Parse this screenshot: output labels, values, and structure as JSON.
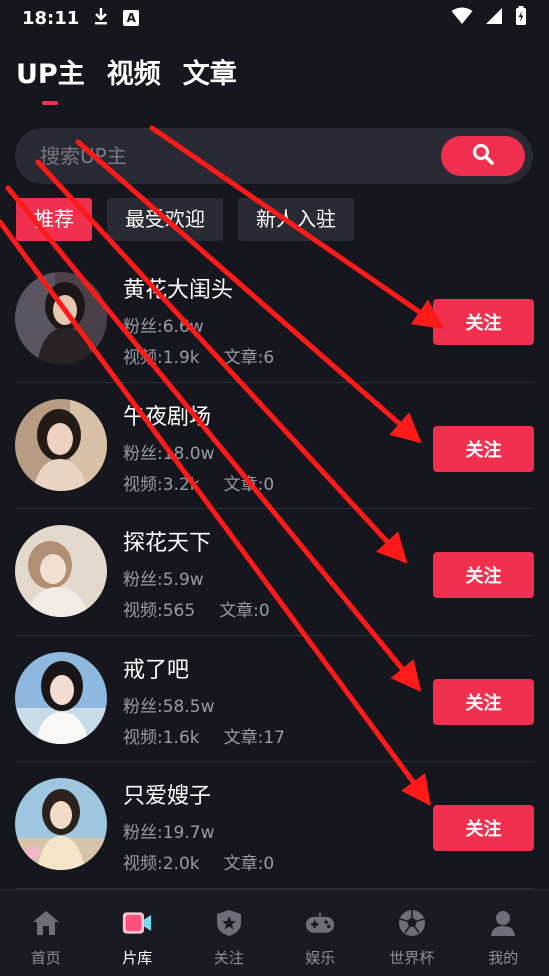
{
  "status_bar": {
    "time": "18:11",
    "notification_badge": "A"
  },
  "top_tabs": [
    {
      "label": "UP主",
      "active": true
    },
    {
      "label": "视频",
      "active": false
    },
    {
      "label": "文章",
      "active": false
    }
  ],
  "search": {
    "placeholder": "搜索UP主"
  },
  "filters": [
    {
      "label": "推荐",
      "active": true
    },
    {
      "label": "最受欢迎",
      "active": false
    },
    {
      "label": "新人入驻",
      "active": false
    }
  ],
  "creators": [
    {
      "name": "黄花大闺头",
      "fans": "粉丝:6.6w",
      "videos": "视频:1.9k",
      "articles": "文章:6",
      "follow_label": "关注"
    },
    {
      "name": "午夜剧场",
      "fans": "粉丝:18.0w",
      "videos": "视频:3.2k",
      "articles": "文章:0",
      "follow_label": "关注"
    },
    {
      "name": "探花天下",
      "fans": "粉丝:5.9w",
      "videos": "视频:565",
      "articles": "文章:0",
      "follow_label": "关注"
    },
    {
      "name": "戒了吧",
      "fans": "粉丝:58.5w",
      "videos": "视频:1.6k",
      "articles": "文章:17",
      "follow_label": "关注"
    },
    {
      "name": "只爱嫂子",
      "fans": "粉丝:19.7w",
      "videos": "视频:2.0k",
      "articles": "文章:0",
      "follow_label": "关注"
    }
  ],
  "bottom_nav": [
    {
      "label": "首页",
      "icon": "home-icon",
      "active": false
    },
    {
      "label": "片库",
      "icon": "video-library-icon",
      "active": true
    },
    {
      "label": "关注",
      "icon": "star-shield-icon",
      "active": false
    },
    {
      "label": "娱乐",
      "icon": "gamepad-icon",
      "active": false
    },
    {
      "label": "世界杯",
      "icon": "soccer-ball-icon",
      "active": false
    },
    {
      "label": "我的",
      "icon": "user-icon",
      "active": false
    }
  ],
  "colors": {
    "accent": "#f0304e",
    "background": "#16161e",
    "surface": "#2a2a35",
    "annotation_arrow": "#ff1a1a"
  }
}
